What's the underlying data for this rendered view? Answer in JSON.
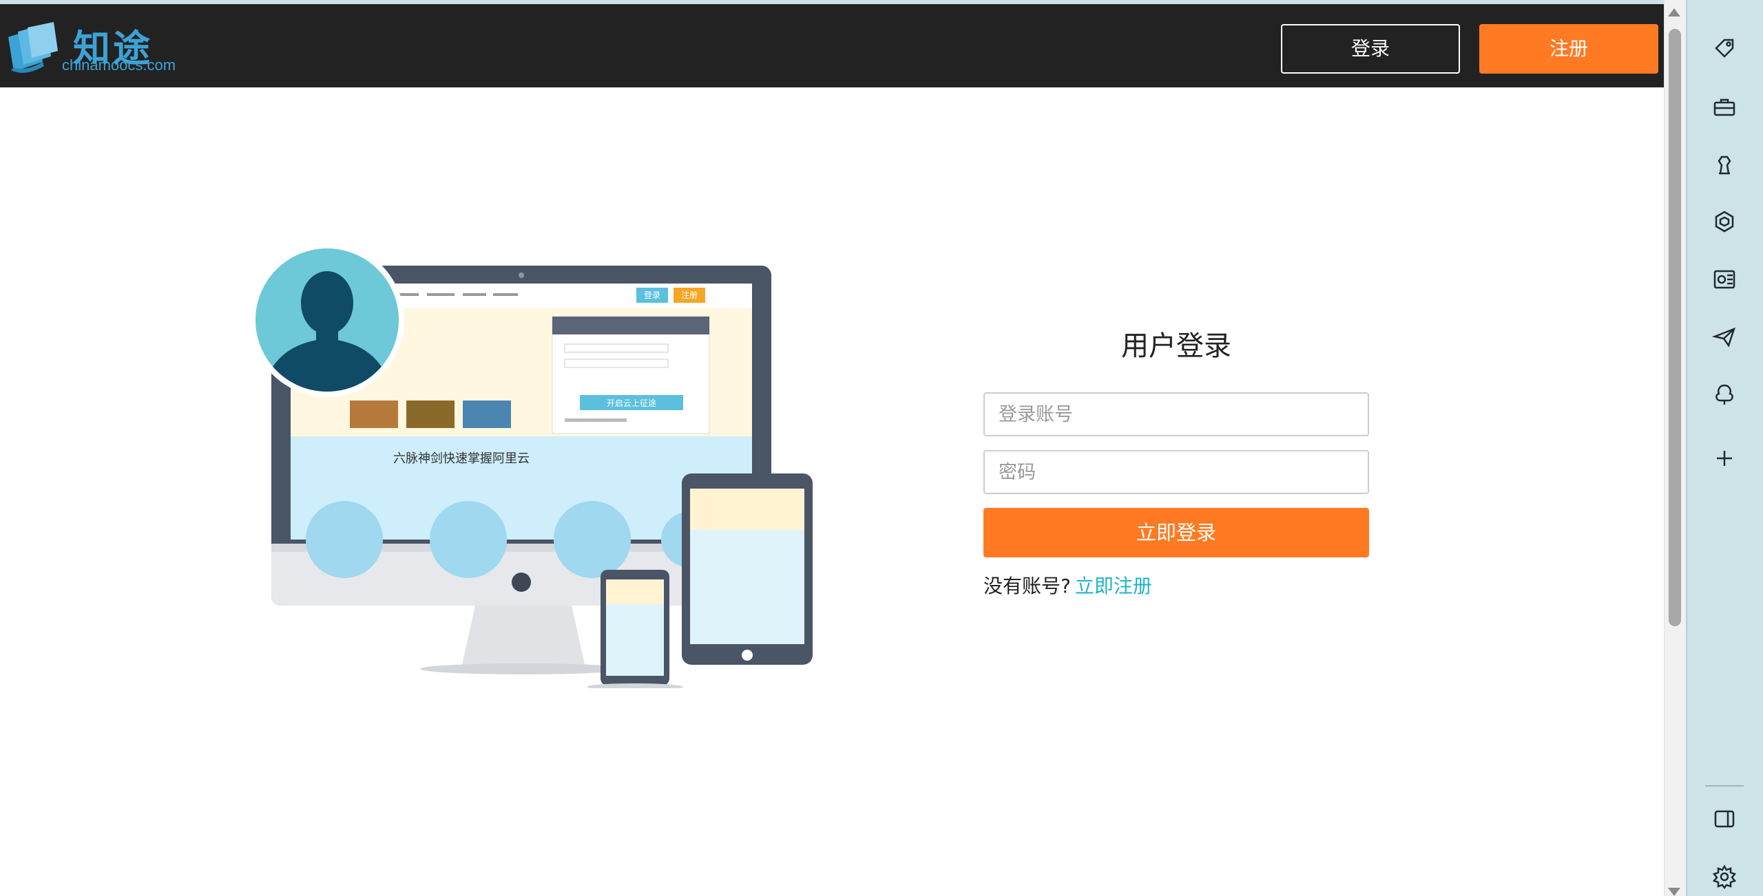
{
  "header": {
    "logo_cn": "知途",
    "logo_en": "chinamoocs.com",
    "login_label": "登录",
    "register_label": "注册"
  },
  "illustration": {
    "banner_text": "六脉神剑快速掌握阿里云",
    "nav_login": "登录",
    "nav_register": "注册",
    "panel_button": "开启云上征途"
  },
  "login": {
    "title": "用户登录",
    "account_placeholder": "登录账号",
    "password_placeholder": "密码",
    "submit_label": "立即登录",
    "no_account_text": "没有账号?",
    "register_link": "立即注册"
  },
  "sidebar": {
    "icons": [
      "tag-icon",
      "toolbox-icon",
      "chess-icon",
      "office-icon",
      "outlook-icon",
      "send-icon",
      "tree-icon",
      "add-icon",
      "panel-icon",
      "settings-icon"
    ]
  },
  "colors": {
    "header_bg": "#222222",
    "accent_orange": "#ff7a22",
    "link_teal": "#20b4c8",
    "logo_blue": "#3ca3d6",
    "sidebar_bg": "#cde3e8"
  }
}
